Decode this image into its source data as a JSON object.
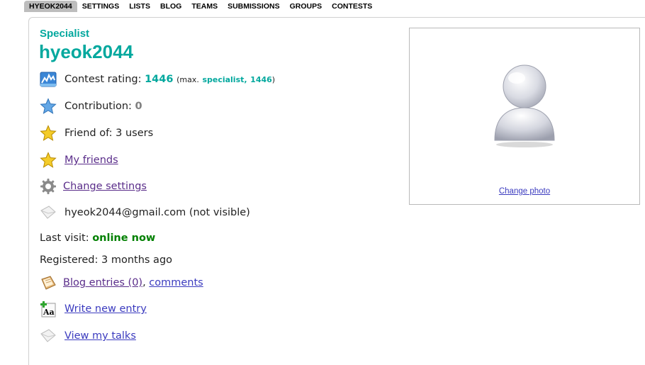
{
  "nav": {
    "tabs": [
      {
        "label": "HYEOK2044",
        "active": true
      },
      {
        "label": "SETTINGS"
      },
      {
        "label": "LISTS"
      },
      {
        "label": "BLOG"
      },
      {
        "label": "TEAMS"
      },
      {
        "label": "SUBMISSIONS"
      },
      {
        "label": "GROUPS"
      },
      {
        "label": "CONTESTS"
      }
    ]
  },
  "profile": {
    "rank": "Specialist",
    "handle": "hyeok2044",
    "rating_label": "Contest rating:",
    "rating_value": "1446",
    "max_prefix": "(max.",
    "max_rank": "specialist,",
    "max_value": "1446",
    "max_suffix": ")",
    "contribution_label": "Contribution:",
    "contribution_value": "0",
    "friend_of": "Friend of: 3 users",
    "my_friends": "My friends",
    "change_settings": "Change settings",
    "email": "hyeok2044@gmail.com (not visible)",
    "last_visit_label": "Last visit:",
    "last_visit_value": "online now",
    "registered": "Registered: 3 months ago",
    "blog_entries": "Blog entries (0)",
    "comma": ",",
    "comments": "comments",
    "write_entry": "Write new entry",
    "view_talks": "View my talks"
  },
  "photo": {
    "change_photo": "Change photo"
  },
  "colors": {
    "specialist": "#03a89e",
    "online": "#008000",
    "link": "#3b3bbf",
    "visited_link": "#5a2d8a"
  },
  "icons": [
    "rating-chart-icon",
    "blue-star-icon",
    "gold-star-icon",
    "gear-icon",
    "envelope-icon",
    "blog-notebook-icon",
    "write-entry-icon",
    "talks-envelope-icon",
    "user-silhouette-icon"
  ]
}
